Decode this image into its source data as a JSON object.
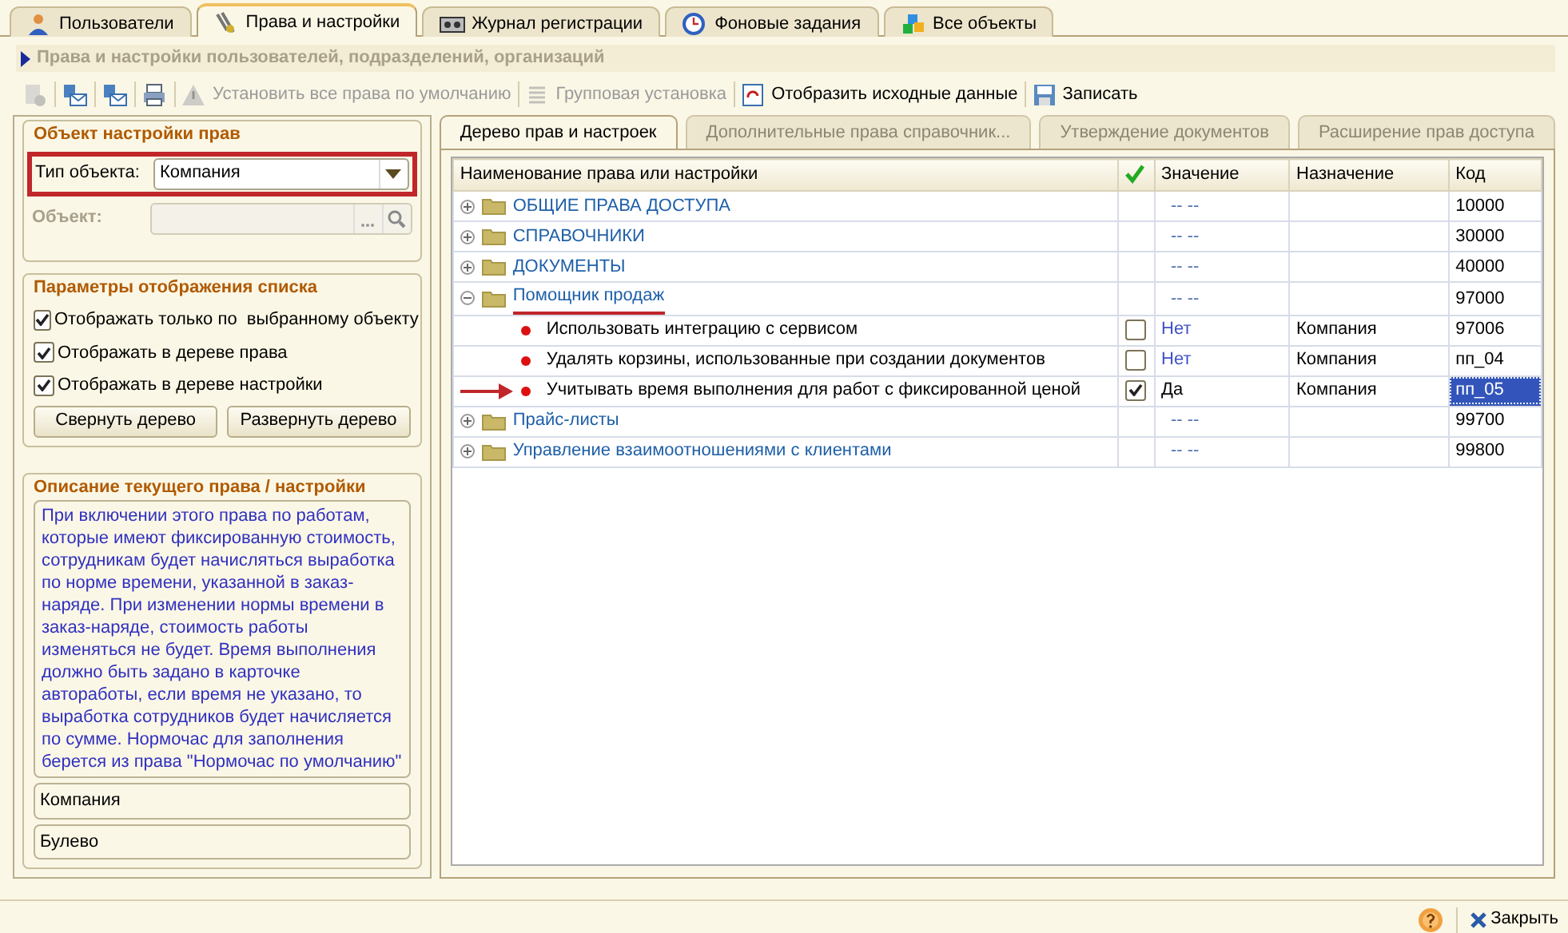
{
  "tabs": [
    {
      "label": "Пользователи",
      "selected": false
    },
    {
      "label": "Права и настройки",
      "selected": true
    },
    {
      "label": "Журнал регистрации",
      "selected": false
    },
    {
      "label": "Фоновые задания",
      "selected": false
    },
    {
      "label": "Все объекты",
      "selected": false
    }
  ],
  "header": {
    "title": "Права и настройки пользователей, подразделений, организаций"
  },
  "toolbar": [
    {
      "disabled": true
    },
    {
      "disabled": false
    },
    {
      "disabled": false
    },
    {
      "disabled": false
    },
    {
      "label": "Установить все права по умолчанию",
      "disabled": true
    },
    {
      "label": "Групповая установка",
      "disabled": true
    },
    {
      "label": "Отобразить исходные данные",
      "disabled": false
    },
    {
      "label": "Записать",
      "disabled": false
    }
  ],
  "object_group": {
    "title": "Объект настройки прав",
    "fields": [
      {
        "label": "Тип объекта:",
        "value": "Компания",
        "disabled": false,
        "highlighted": true
      },
      {
        "label": "Объект:",
        "disabled": true,
        "highlighted": false
      }
    ]
  },
  "display_group": {
    "title": "Параметры отображения списка",
    "checkboxes": [
      {
        "label": "Отображать только по  выбранному объекту",
        "checked": true
      },
      {
        "label": "Отображать в дереве права",
        "checked": true
      },
      {
        "label": "Отображать в дереве настройки",
        "checked": true
      }
    ],
    "buttons": [
      "Свернуть дерево",
      "Развернуть дерево"
    ]
  },
  "description_group": {
    "title": "Описание текущего права / настройки",
    "text": "При включении этого права по работам, которые имеют фиксированную стоимость, сотрудникам будет начисляться выработка по норме времени, указанной в заказ-наряде. При изменении нормы времени в заказ-наряде, стоимость работы изменяться не будет. Время выполнения должно быть задано в карточке автоработы, если время не указано, то выработка сотрудников будет начисляется по сумме. Нормочас для заполнения берется из права \"Нормочас по умолчанию\"",
    "fields": [
      "Компания",
      "Булево"
    ]
  },
  "subtabs": [
    {
      "label": "Дерево прав и настроек",
      "selected": true
    },
    {
      "label": "Дополнительные права справочник...",
      "selected": false
    },
    {
      "label": "Утверждение документов",
      "selected": false
    },
    {
      "label": "Расширение прав доступа",
      "selected": false
    }
  ],
  "table": {
    "columns": [
      "Наименование права или настройки",
      "Значение",
      "Назначение",
      "Код"
    ],
    "rows": [
      {
        "name": "ОБЩИЕ ПРАВА ДОСТУПА",
        "value": "-- --",
        "code": "10000",
        "expanded": false,
        "underlined": false
      },
      {
        "name": "СПРАВОЧНИКИ",
        "value": "-- --",
        "code": "30000",
        "expanded": false,
        "underlined": false
      },
      {
        "name": "ДОКУМЕНТЫ",
        "value": "-- --",
        "code": "40000",
        "expanded": false,
        "underlined": false
      },
      {
        "name": "Помощник продаж",
        "value": "-- --",
        "code": "97000",
        "expanded": true,
        "underlined": true,
        "children": [
          {
            "name": "Использовать интеграцию с сервисом",
            "checked": false,
            "value": "Нет",
            "assignment": "Компания",
            "code": "97006",
            "selected": false,
            "arrow": false
          },
          {
            "name": "Удалять корзины, использованные при создании документов",
            "checked": false,
            "value": "Нет",
            "assignment": "Компания",
            "code": "пп_04",
            "selected": false,
            "arrow": false
          },
          {
            "name": "Учитывать время выполнения для работ с фиксированной ценой",
            "checked": true,
            "value": "Да",
            "assignment": "Компания",
            "code": "пп_05",
            "selected": true,
            "arrow": true
          }
        ]
      },
      {
        "name": "Прайс-листы",
        "value": "-- --",
        "code": "99700",
        "expanded": false,
        "underlined": false
      },
      {
        "name": "Управление взаимоотношениями с клиентами",
        "value": "-- --",
        "code": "99800",
        "expanded": false,
        "underlined": false
      }
    ]
  },
  "footer": {
    "close_label": "Закрыть"
  }
}
